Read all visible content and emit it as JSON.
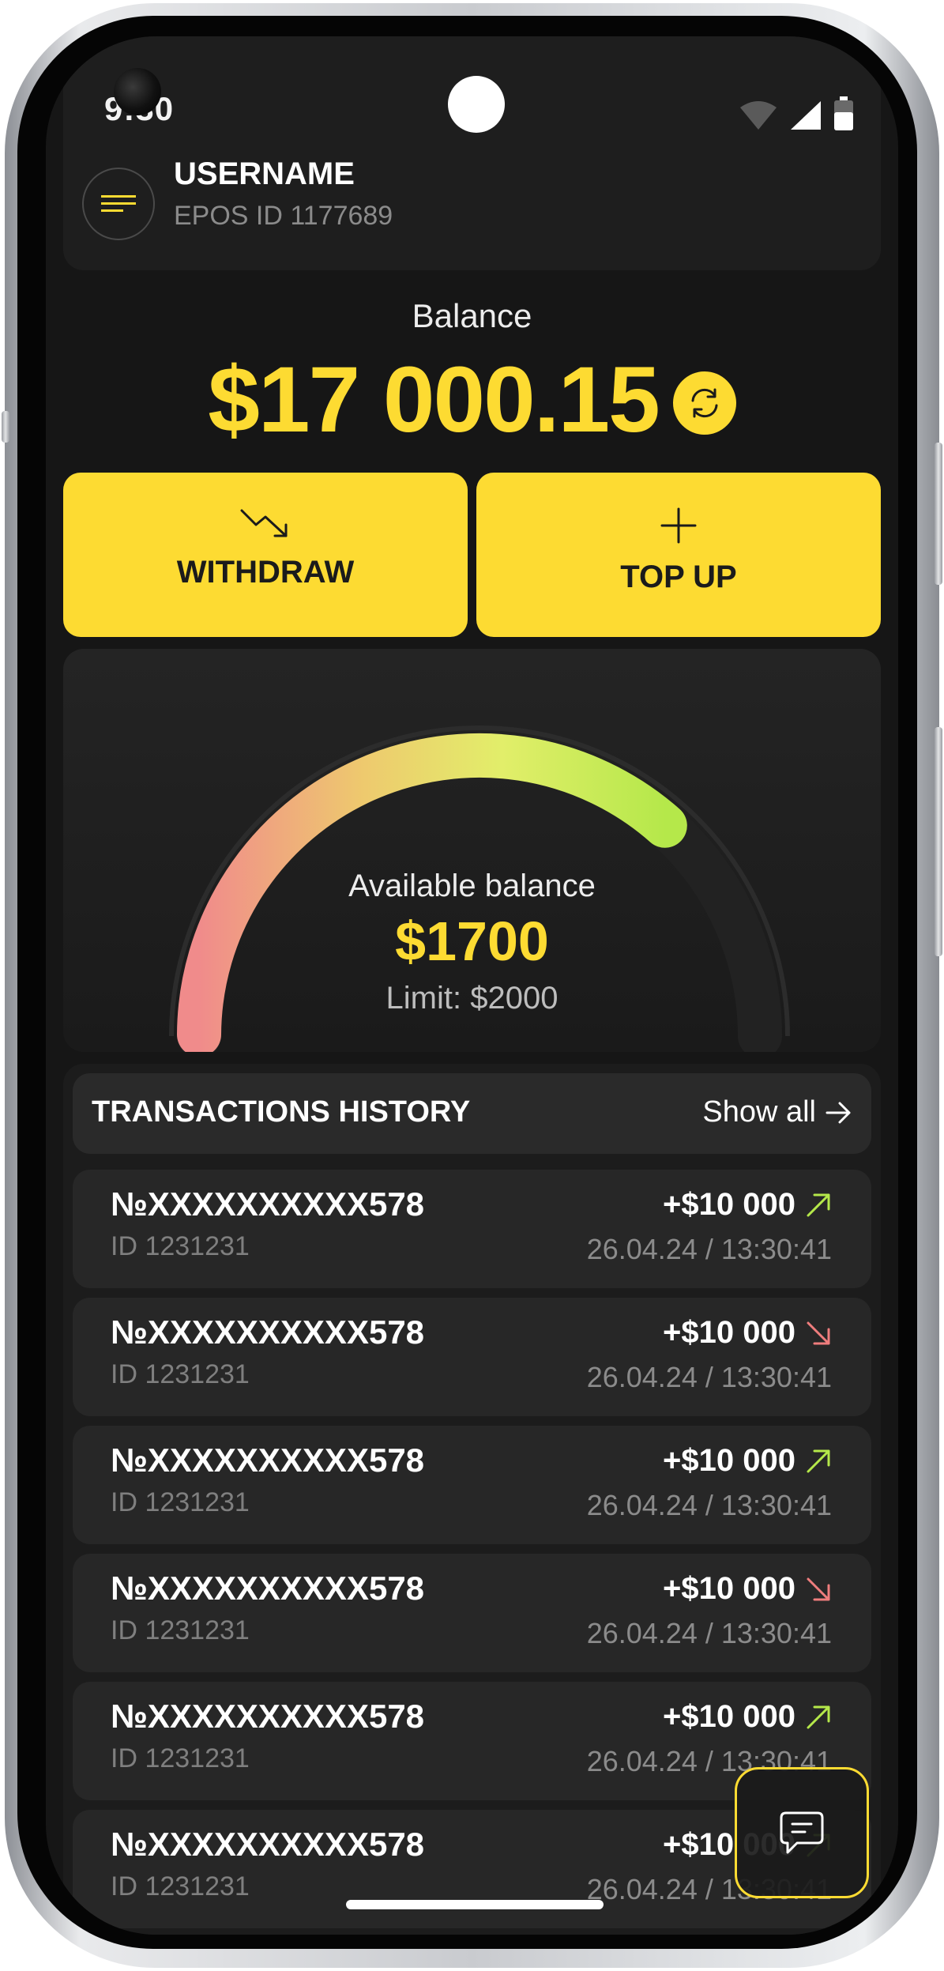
{
  "status_bar": {
    "time": "9:30"
  },
  "header": {
    "username": "USERNAME",
    "epos_id": "EPOS ID 1177689"
  },
  "balance": {
    "label": "Balance",
    "amount": "$17 000.15"
  },
  "actions": {
    "withdraw_label": "WITHDRAW",
    "topup_label": "TOP UP"
  },
  "available": {
    "label": "Available balance",
    "amount": "$1700",
    "limit": "Limit: $2000",
    "used_fraction": 0.85
  },
  "transactions": {
    "title": "TRANSACTIONS HISTORY",
    "show_all": "Show all",
    "rows": [
      {
        "number": "№XXXXXXXXXX578",
        "id": "ID 1231231",
        "amount": "+$10 000",
        "date": "26.04.24 / 13:30:41",
        "direction": "up"
      },
      {
        "number": "№XXXXXXXXXX578",
        "id": "ID 1231231",
        "amount": "+$10 000",
        "date": "26.04.24 / 13:30:41",
        "direction": "down"
      },
      {
        "number": "№XXXXXXXXXX578",
        "id": "ID 1231231",
        "amount": "+$10 000",
        "date": "26.04.24 / 13:30:41",
        "direction": "up"
      },
      {
        "number": "№XXXXXXXXXX578",
        "id": "ID 1231231",
        "amount": "+$10 000",
        "date": "26.04.24 / 13:30:41",
        "direction": "down"
      },
      {
        "number": "№XXXXXXXXXX578",
        "id": "ID 1231231",
        "amount": "+$10 000",
        "date": "26.04.24 / 13:30:41",
        "direction": "up"
      },
      {
        "number": "№XXXXXXXXXX578",
        "id": "ID 1231231",
        "amount": "+$10 000",
        "date": "26.04.24 / 13:30:41",
        "direction": "up"
      }
    ]
  },
  "colors": {
    "accent": "#fddb32",
    "up": "#b5e84a",
    "down": "#ef7d7d",
    "background": "#161616"
  },
  "icons": {
    "menu": "menu-icon",
    "refresh": "refresh-icon",
    "withdraw": "trend-down-icon",
    "topup": "plus-icon",
    "show_all": "arrow-right-icon",
    "chat": "chat-icon"
  }
}
